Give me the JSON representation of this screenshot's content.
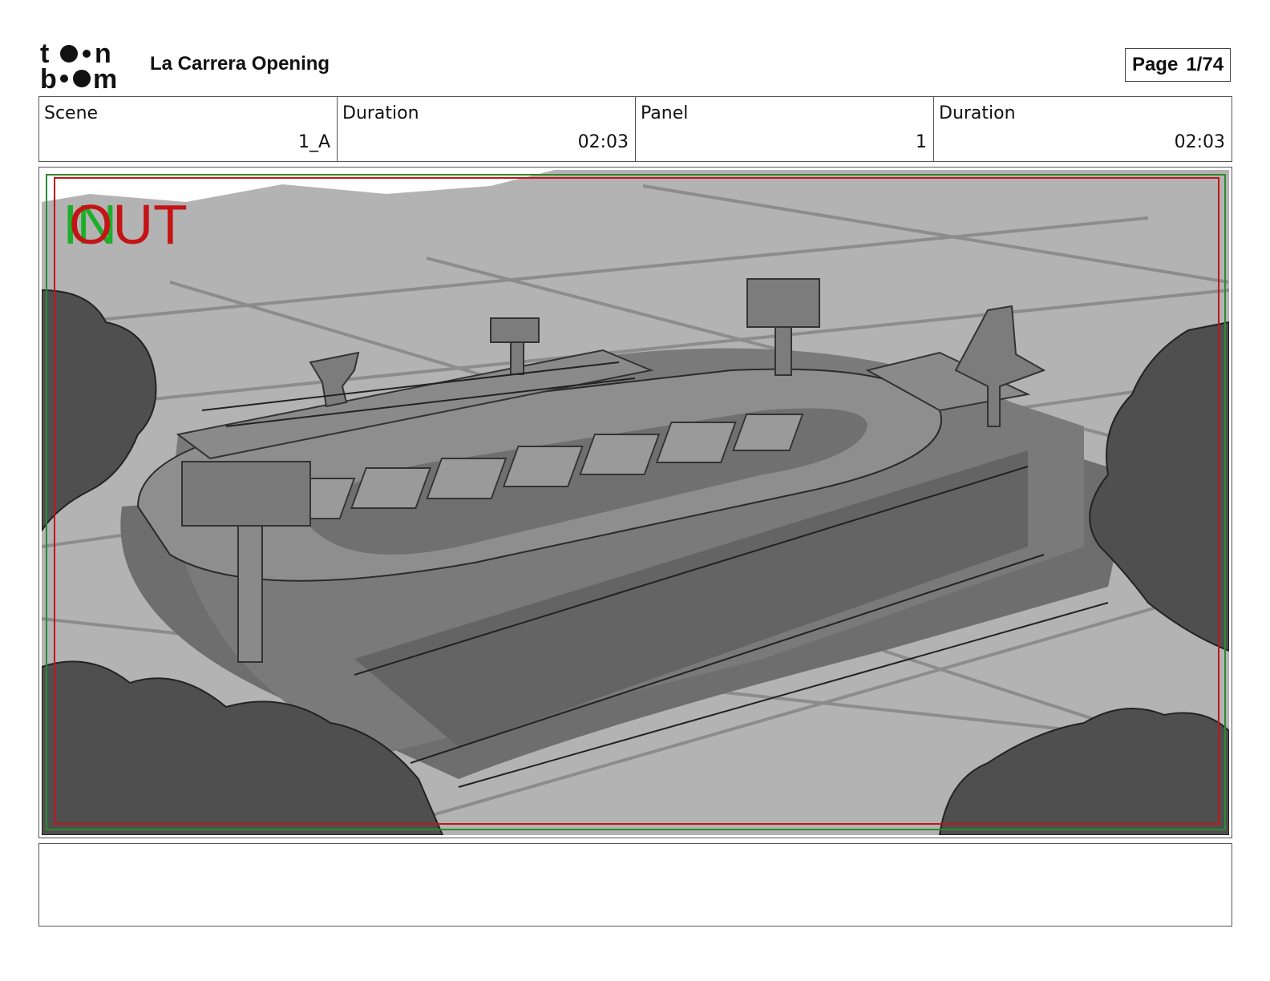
{
  "header": {
    "logo_text": "toon boom",
    "project_title": "La Carrera Opening",
    "page_label": "Page",
    "page_number": "1/74"
  },
  "info": [
    {
      "label": "Scene",
      "value": "1_A"
    },
    {
      "label": "Duration",
      "value": "02:03"
    },
    {
      "label": "Panel",
      "value": "1"
    },
    {
      "label": "Duration",
      "value": "02:03"
    }
  ],
  "panel": {
    "in_marker": "IN",
    "out_marker": "OUT",
    "colors": {
      "in": "#1fae2a",
      "out": "#c41416",
      "title_safe": "#c41416",
      "action_safe": "#2e8a2e"
    }
  },
  "dialogue": ""
}
